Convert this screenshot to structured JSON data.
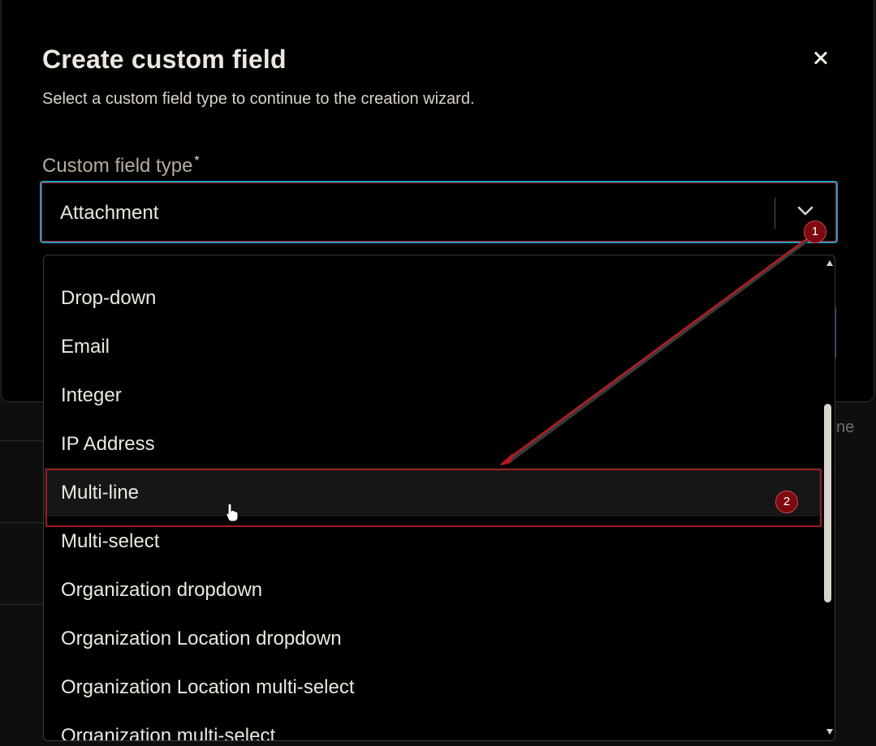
{
  "modal": {
    "title": "Create custom field",
    "subtitle": "Select a custom field type to continue to the creation wizard."
  },
  "field": {
    "label": "Custom field type",
    "required_mark": "*",
    "selected_value": "Attachment"
  },
  "dropdown": {
    "options": [
      "Drop-down",
      "Email",
      "Integer",
      "IP Address",
      "Multi-line",
      "Multi-select",
      "Organization dropdown",
      "Organization Location dropdown",
      "Organization Location multi-select",
      "Organization multi-select"
    ],
    "hovered_option": "Multi-line"
  },
  "background": {
    "partial_text": "ne"
  },
  "annotations": {
    "marker_1": "1",
    "marker_2": "2",
    "color": "#9d1c24"
  },
  "colors": {
    "focus_border": "#1f9fc0",
    "modal_bg": "#000000",
    "text": "#ece7df"
  }
}
